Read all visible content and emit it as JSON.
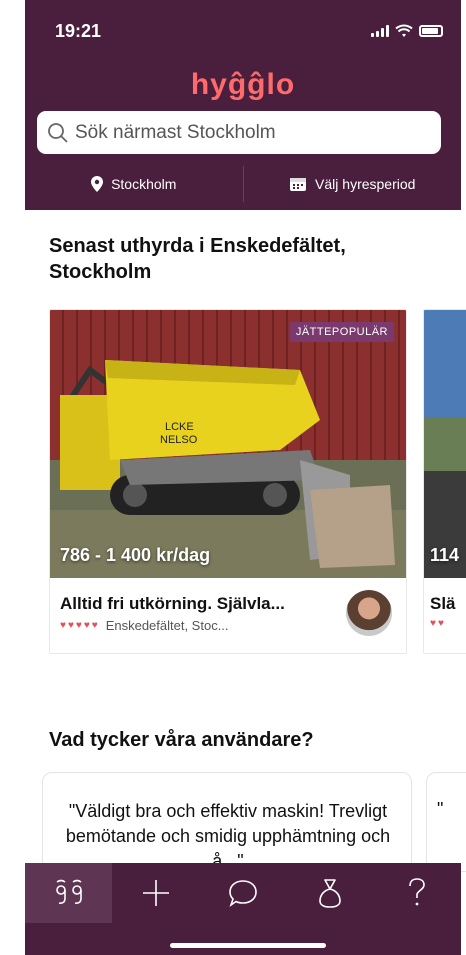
{
  "status": {
    "time": "19:21"
  },
  "app": {
    "logo": "hyĝĝlo",
    "brand_color": "#4a1f3d",
    "accent_color": "#ff6b6b"
  },
  "search": {
    "placeholder": "Sök närmast Stockholm"
  },
  "location": {
    "city": "Stockholm",
    "period": "Välj hyresperiod",
    "city_icon": "location-pin-icon",
    "period_icon": "calendar-icon"
  },
  "recent": {
    "title": "Senast uthyrda i Enskedefältet, Stockholm",
    "cards": [
      {
        "badge": "JÄTTEPOPULÄR",
        "price": "786 - 1 400 kr/dag",
        "title": "Alltid fri utkörning. Självla...",
        "location": "Enskedefältet, Stoc...",
        "hearts": 5
      },
      {
        "price": "114",
        "title": "Slä",
        "hearts": 2
      }
    ]
  },
  "reviews": {
    "title": "Vad tycker våra användare?",
    "items": [
      {
        "text": "\"Väldigt bra och effektiv maskin! Trevligt bemötande och smidig upphämtning och å...\""
      },
      {
        "text": "\""
      }
    ]
  },
  "tabbar": {
    "items": [
      {
        "name": "home",
        "icon": "hygglo-logo-icon",
        "active": true
      },
      {
        "name": "add",
        "icon": "plus-icon",
        "active": false
      },
      {
        "name": "messages",
        "icon": "chat-bubble-icon",
        "active": false
      },
      {
        "name": "profile",
        "icon": "profile-icon",
        "active": false
      },
      {
        "name": "help",
        "icon": "help-icon",
        "active": false
      }
    ]
  }
}
